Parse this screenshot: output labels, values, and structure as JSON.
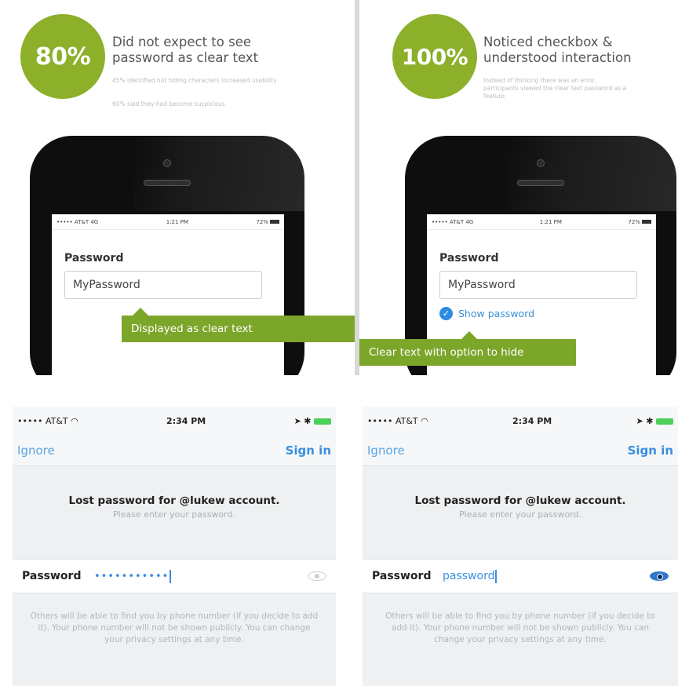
{
  "left_panel": {
    "stat": "80%",
    "heading": "Did not expect to see password as clear text",
    "note1": "45% identified not hiding characters increased usability",
    "note2": "60% said they had become suspicious",
    "phone": {
      "carrier": "••••• AT&T 4G",
      "time": "1:21 PM",
      "battery": "72%",
      "field_label": "Password",
      "field_value": "MyPassword"
    },
    "callout": "Displayed as clear text"
  },
  "right_panel": {
    "stat": "100%",
    "heading": "Noticed checkbox & understood interaction",
    "note1": "Instead of thinking there was an error, participants viewed the clear text password as a feature",
    "phone": {
      "carrier": "••••• AT&T 4G",
      "time": "1:21 PM",
      "battery": "72%",
      "field_label": "Password",
      "field_value": "MyPassword",
      "show_password": "Show password"
    },
    "callout": "Clear text with option to hide"
  },
  "ios_left": {
    "carrier": "••••• AT&T",
    "time": "2:34 PM",
    "nav_left": "Ignore",
    "nav_right": "Sign in",
    "msg_title": "Lost password for @lukew account.",
    "msg_sub": "Please enter your password.",
    "pw_label": "Password",
    "pw_value": "•••••••••••",
    "footer": "Others will be able to find you by phone number (if you decide to add it). Your phone number will not be shown publicly. You can change your privacy settings at any time."
  },
  "ios_right": {
    "carrier": "••••• AT&T",
    "time": "2:34 PM",
    "nav_left": "Ignore",
    "nav_right": "Sign in",
    "msg_title": "Lost password for @lukew account.",
    "msg_sub": "Please enter your password.",
    "pw_label": "Password",
    "pw_value": "password",
    "footer": "Others will be able to find you by phone number (if you decide to add it). Your phone number will not be shown publicly. You can change your privacy settings at any time."
  },
  "colors": {
    "accent_green": "#8cb02a",
    "callout_green": "#7ca62a",
    "ios_blue": "#3a8fe0"
  }
}
